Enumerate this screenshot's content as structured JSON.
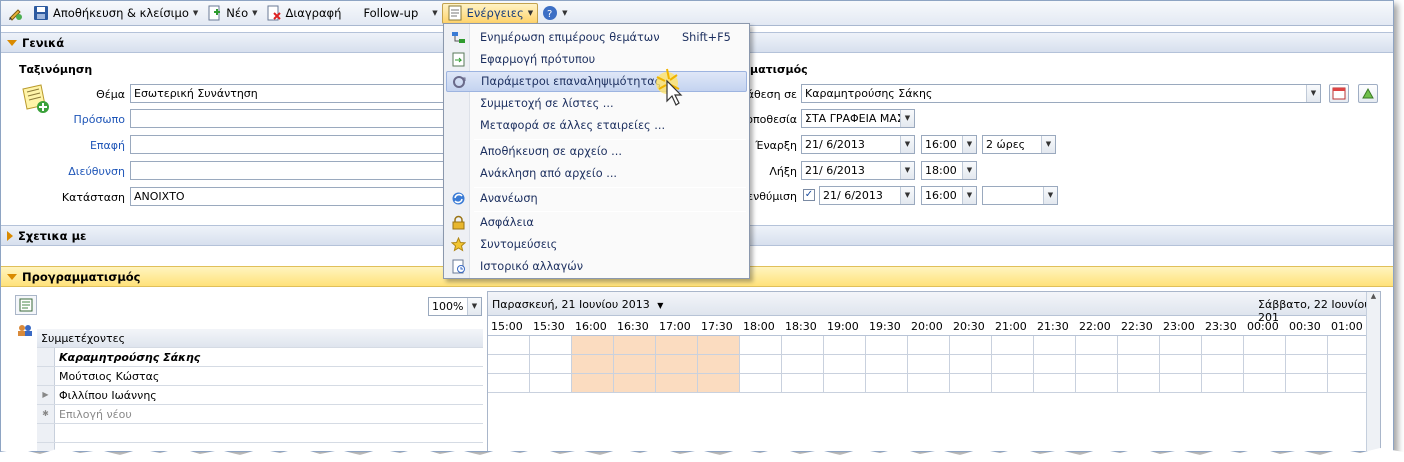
{
  "toolbar": {
    "save_close": "Αποθήκευση & κλείσιμο",
    "new": "Νέο",
    "delete": "Διαγραφή",
    "followup": "Follow-up",
    "actions": "Ενέργειες"
  },
  "general": {
    "section_title": "Γενικά",
    "classification_title": "Ταξινόμηση",
    "labels": {
      "subject": "Θέμα",
      "person": "Πρόσωπο",
      "contact": "Επαφή",
      "address": "Διεύθυνση",
      "status": "Κατάσταση"
    },
    "values": {
      "subject": "Εσωτερική Συνάντηση",
      "status": "ΑΝΟΙΧΤΟ"
    },
    "schedule_title": "ματισμός",
    "right_labels": {
      "assign": "άθεση σε",
      "location": "οποθεσία",
      "start": "Έναρξη",
      "end": "Λήξη",
      "reminder": "ενθύμιση"
    },
    "right_values": {
      "assign": "Καραμητρούσης Σάκης",
      "location": "ΣΤΑ ΓΡΑΦΕΙΑ ΜΑΣ",
      "start_date": "21/ 6/2013",
      "start_time": "16:00",
      "duration": "2 ώρες",
      "end_date": "21/ 6/2013",
      "end_time": "18:00",
      "reminder_date": "21/ 6/2013",
      "reminder_time": "16:00",
      "reminder_checked": "✓"
    }
  },
  "related": {
    "section_title": "Σχετικα με"
  },
  "planning": {
    "section_title": "Προγραμματισμός",
    "zoom": "100%",
    "participants_header": "Συμμετέχοντες",
    "participants": [
      "Καραμητρούσης Σάκης",
      "Μούτσιος Κώστας",
      "Φιλλίπου Ιωάννης"
    ],
    "new_row": "Επιλογή νέου",
    "date_left": "Παρασκευή, 21 Ιουνίου 2013",
    "date_right": "Σάββατο, 22 Ιουνίου 201",
    "hours": [
      "15:00",
      "15:30",
      "16:00",
      "16:30",
      "17:00",
      "17:30",
      "18:00",
      "18:30",
      "19:00",
      "19:30",
      "20:00",
      "20:30",
      "21:00",
      "21:30",
      "22:00",
      "22:30",
      "23:00",
      "23:30",
      "00:00",
      "00:30",
      "01:00"
    ]
  },
  "menu": {
    "items": [
      {
        "label": "Ενημέρωση επιμέρους θεμάτων",
        "shortcut": "Shift+F5"
      },
      {
        "label": "Εφαρμογή πρότυπου"
      },
      {
        "label": "Παράμετροι επαναληψιμότητας"
      },
      {
        "label": "Συμμετοχή σε λίστες ..."
      },
      {
        "label": "Μεταφορά σε άλλες εταιρείες ..."
      },
      {
        "label": "Αποθήκευση σε αρχείο ..."
      },
      {
        "label": "Ανάκληση από αρχείο ..."
      },
      {
        "label": "Ανανέωση"
      },
      {
        "label": "Ασφάλεια"
      },
      {
        "label": "Συντομεύσεις"
      },
      {
        "label": "Ιστορικό αλλαγών"
      }
    ]
  }
}
